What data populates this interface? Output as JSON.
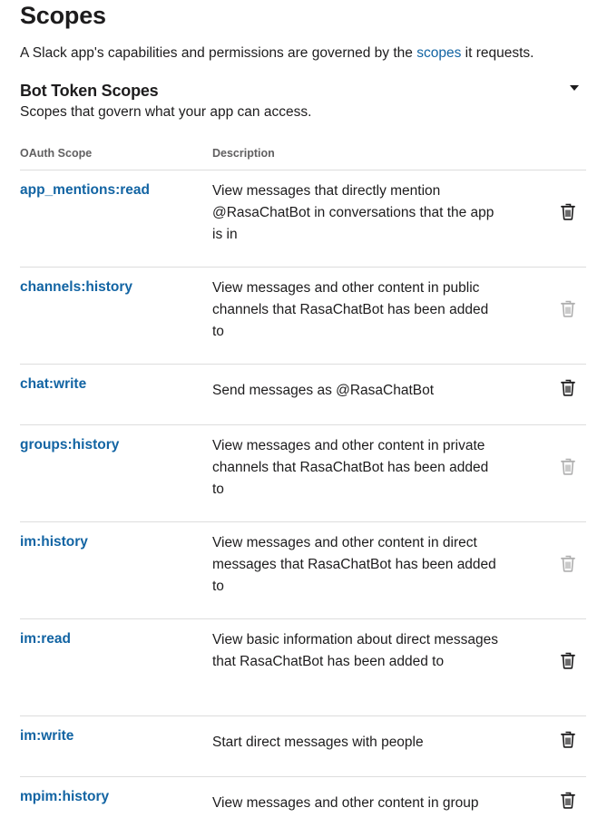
{
  "header": {
    "title": "Scopes",
    "intro_prefix": "A Slack app's capabilities and permissions are governed by the ",
    "intro_link": "scopes",
    "intro_suffix": " it requests."
  },
  "section": {
    "title": "Bot Token Scopes",
    "subtitle": "Scopes that govern what your app can access.",
    "toggle_icon": "caret-down-icon"
  },
  "table": {
    "col_scope": "OAuth Scope",
    "col_description": "Description",
    "rows": [
      {
        "scope": "app_mentions:read",
        "description": "View messages that directly mention @RasaChatBot in conversations that the app is in",
        "removable": true
      },
      {
        "scope": "channels:history",
        "description": "View messages and other content in public channels that RasaChatBot has been added to",
        "removable": false
      },
      {
        "scope": "chat:write",
        "description": "Send messages as @RasaChatBot",
        "removable": true
      },
      {
        "scope": "groups:history",
        "description": "View messages and other content in private channels that RasaChatBot has been added to",
        "removable": false
      },
      {
        "scope": "im:history",
        "description": "View messages and other content in direct messages that RasaChatBot has been added to",
        "removable": false
      },
      {
        "scope": "im:read",
        "description": "View basic information about direct messages that RasaChatBot has been added to",
        "removable": true
      },
      {
        "scope": "im:write",
        "description": "Start direct messages with people",
        "removable": true
      },
      {
        "scope": "mpim:history",
        "description": "View messages and other content in group",
        "removable": true
      }
    ],
    "remove_icon": "trash-icon"
  },
  "colors": {
    "link": "#1264a3",
    "text": "#1d1c1d",
    "muted": "#616061",
    "divider": "#dddddd"
  }
}
